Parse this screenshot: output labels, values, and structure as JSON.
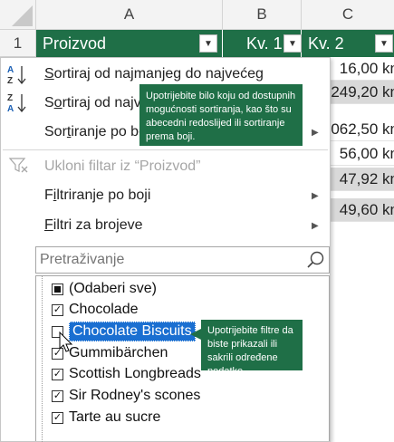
{
  "grid": {
    "columns": [
      "A",
      "B",
      "C"
    ],
    "rows": [
      "1"
    ],
    "header_cells": [
      "Proizvod",
      "Kv. 1",
      "Kv. 2"
    ],
    "col_c_values": [
      "16,00 kn",
      "249,20 kn",
      "062,50 kn",
      "56,00 kn",
      "47,92 kn",
      "49,60 kn"
    ]
  },
  "menu": {
    "sort_asc": {
      "underline": "S",
      "rest": "ortiraj od najmanjeg do najvećeg"
    },
    "sort_desc": {
      "underline": "o",
      "pre": "S",
      "rest": "rtiraj od najv"
    },
    "sort_color": {
      "pre": "Sor",
      "underline": "t",
      "rest": "iranje po bo"
    },
    "clear_filter": "Ukloni filtar iz “Proizvod”",
    "filter_color": {
      "underline": "i",
      "pre": "F",
      "rest": "ltriranje po boji"
    },
    "number_filters": {
      "underline": "F",
      "rest": "iltri za brojeve"
    },
    "search_placeholder": "Pretraživanje",
    "items": [
      "(Odaberi sve)",
      "Chocolade",
      "Chocolate Biscuits",
      "Gummibärchen",
      "Scottish Longbreads",
      "Sir Rodney's scones",
      "Tarte au sucre"
    ]
  },
  "callouts": {
    "sort": "Upotrijebite bilo koju od dostupnih mogućnosti sortiranja, kao što su abecedni redoslijed ili sortiranje prema boji.",
    "filter": "Upotrijebite filtre da biste prikazali ili sakrili određene podatke."
  },
  "colors": {
    "header_green": "#1f6f47",
    "callout_green": "#1f6f47",
    "highlight_blue": "#1a6fd1"
  }
}
